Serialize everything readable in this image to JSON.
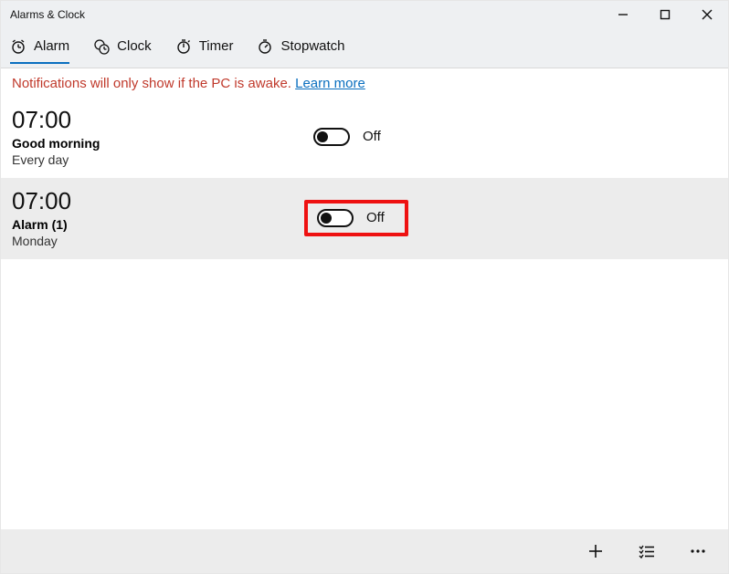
{
  "window": {
    "title": "Alarms & Clock"
  },
  "tabs": {
    "alarm": "Alarm",
    "clock": "Clock",
    "timer": "Timer",
    "stopwatch": "Stopwatch"
  },
  "notice": {
    "text": "Notifications will only show if the PC is awake. ",
    "link": "Learn more"
  },
  "alarms": [
    {
      "time": "07:00",
      "name": "Good morning",
      "days": "Every day",
      "state": "Off"
    },
    {
      "time": "07:00",
      "name": "Alarm (1)",
      "days": "Monday",
      "state": "Off"
    }
  ]
}
